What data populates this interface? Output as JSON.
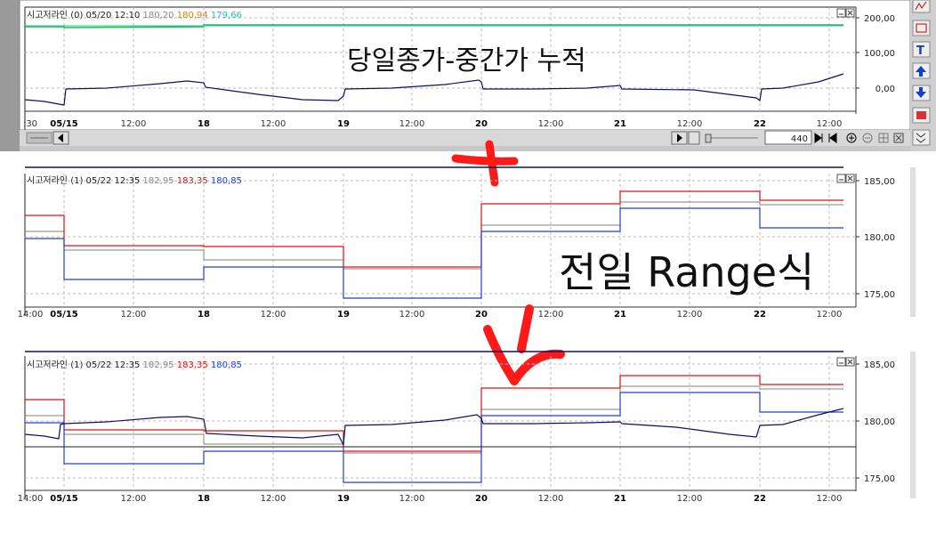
{
  "panels": [
    {
      "id": "p1",
      "header": {
        "name": "시고저라인",
        "info": "(0) 05/20 12:10",
        "v1": "180,20",
        "v2": "180,94",
        "v3": "179,66"
      },
      "annotation": "당일종가-중간가 누적",
      "yticks": [
        "200,00",
        "100,00",
        "0,00"
      ],
      "xticks": [
        ":30",
        "05/15",
        "12:00",
        "18",
        "12:00",
        "19",
        "12:00",
        "20",
        "12:00",
        "21",
        "12:00",
        "22",
        "12:00"
      ],
      "zoom_value": "440"
    },
    {
      "id": "p2",
      "header": {
        "name": "시고저라인",
        "info": "(1) 05/22 12:35",
        "v1": "182,95",
        "v2": "183,35",
        "v3": "180,85"
      },
      "annotation": "전일 Range식",
      "yticks": [
        "185,00",
        "180,00",
        "175,00"
      ],
      "xticks": [
        "14:00",
        "05/15",
        "12:00",
        "18",
        "12:00",
        "19",
        "12:00",
        "20",
        "12:00",
        "21",
        "12:00",
        "22",
        "12:00"
      ]
    },
    {
      "id": "p3",
      "header": {
        "name": "시고저라인",
        "info": "(1) 05/22 12:35",
        "v1": "182,95",
        "v2": "183,35",
        "v3": "180,85"
      },
      "yticks": [
        "185,00",
        "180,00",
        "175,00"
      ],
      "xticks": [
        "14:00",
        "05/15",
        "12:00",
        "18",
        "12:00",
        "19",
        "12:00",
        "20",
        "12:00",
        "21",
        "12:00",
        "22",
        "12:00"
      ]
    }
  ],
  "colors": {
    "red": "#e01010",
    "blue": "#2040d0",
    "navy": "#101060",
    "green": "#20c040",
    "cyan": "#20c0c0",
    "orange": "#e08000",
    "marker": "#ff1a1a"
  },
  "toolbar_icons": [
    "chart-icon",
    "indicator-icon",
    "text-tool-icon",
    "up-arrow-icon",
    "down-arrow-icon",
    "stop-icon",
    "expand-icon"
  ]
}
